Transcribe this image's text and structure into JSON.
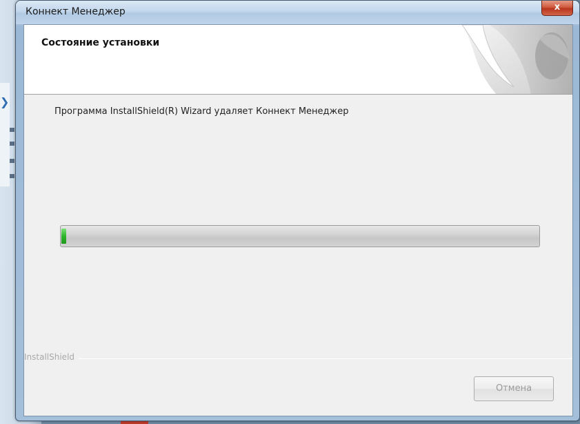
{
  "window": {
    "title": "Коннект Менеджер",
    "close_label": "x"
  },
  "header": {
    "title": "Состояние установки"
  },
  "main": {
    "status_text": "Программа InstallShield(R) Wizard удаляет Коннект Менеджер",
    "progress_fraction": 0.01
  },
  "footer": {
    "brand": "InstallShield",
    "cancel_label": "Отмена"
  },
  "icons": {
    "close": "close-icon",
    "header_graphic": "installshield-graphic-icon"
  },
  "colors": {
    "progress": "#2cb52a",
    "close_button": "#cf5a3f"
  }
}
